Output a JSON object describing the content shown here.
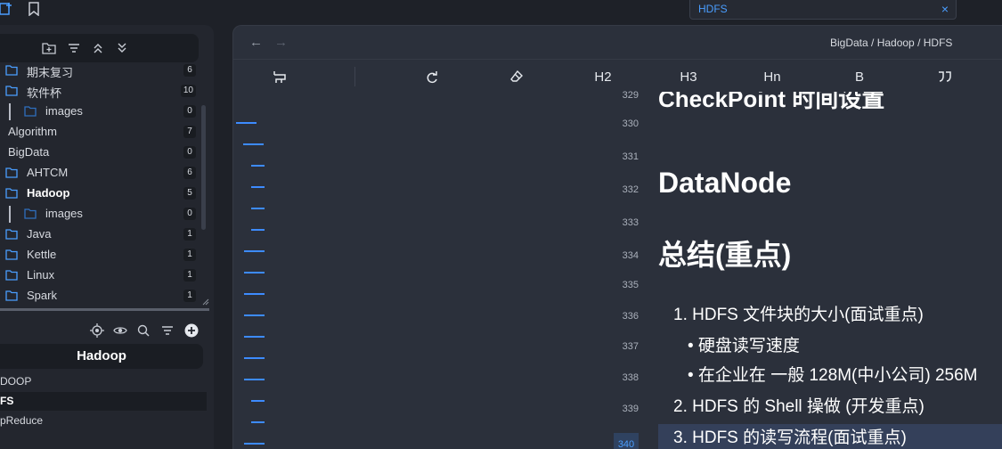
{
  "top_search": {
    "value": "HDFS",
    "close_label": "×"
  },
  "sidebar": {
    "tree": [
      {
        "label": "期末复习",
        "count": "6",
        "indent": 1,
        "guide": false,
        "bold": false,
        "folder": true
      },
      {
        "label": "软件杯",
        "count": "10",
        "indent": 1,
        "guide": false,
        "bold": false,
        "folder": true
      },
      {
        "label": "images",
        "count": "0",
        "indent": 2,
        "guide": true,
        "bold": false,
        "folder": true
      },
      {
        "label": "Algorithm",
        "count": "7",
        "indent": 0,
        "guide": false,
        "bold": false,
        "folder": false
      },
      {
        "label": "BigData",
        "count": "0",
        "indent": 0,
        "guide": false,
        "bold": false,
        "folder": false
      },
      {
        "label": "AHTCM",
        "count": "6",
        "indent": 1,
        "guide": false,
        "bold": false,
        "folder": true
      },
      {
        "label": "Hadoop",
        "count": "5",
        "indent": 1,
        "guide": false,
        "bold": true,
        "folder": true
      },
      {
        "label": "images",
        "count": "0",
        "indent": 2,
        "guide": true,
        "bold": false,
        "folder": true
      },
      {
        "label": "Java",
        "count": "1",
        "indent": 1,
        "guide": false,
        "bold": false,
        "folder": true
      },
      {
        "label": "Kettle",
        "count": "1",
        "indent": 1,
        "guide": false,
        "bold": false,
        "folder": true
      },
      {
        "label": "Linux",
        "count": "1",
        "indent": 1,
        "guide": false,
        "bold": false,
        "folder": true
      },
      {
        "label": "Spark",
        "count": "1",
        "indent": 1,
        "guide": false,
        "bold": false,
        "folder": true
      }
    ],
    "outline_title": "Hadoop",
    "outline_items": [
      {
        "label": "DOOP",
        "active": false
      },
      {
        "label": "FS",
        "active": true
      },
      {
        "label": "pReduce",
        "active": false
      }
    ]
  },
  "editor": {
    "breadcrumb": "BigData / Hadoop / HDFS",
    "toolbar": {
      "h2": "H2",
      "h3": "H3",
      "hn": "Hn",
      "bold": "B"
    },
    "line_numbers": [
      "329",
      "330",
      "331",
      "332",
      "333",
      "334",
      "335",
      "336",
      "337",
      "338",
      "339",
      "340"
    ],
    "current_line": "340",
    "lines": {
      "heading_partial": "CheckPoint 时间设置",
      "datanode": "DataNode",
      "summary": "总结(重点)",
      "item1": "1. HDFS 文件块的大小(面试重点)",
      "item1_b1": "• 硬盘读写速度",
      "item1_b2": "• 在企业在 一般 128M(中小公司) 256M",
      "item2": "2. HDFS 的 Shell 操做 (开发重点)",
      "item3": "3. HDFS 的读写流程(面试重点)"
    }
  },
  "colors": {
    "accent": "#4a9eff",
    "bg": "#1e2128",
    "panel": "#2b303b"
  }
}
